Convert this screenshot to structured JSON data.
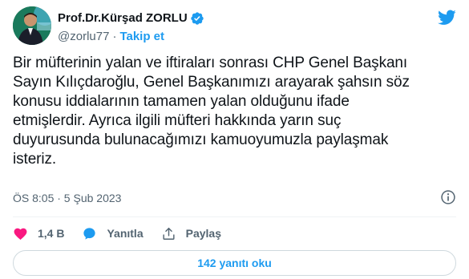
{
  "author": {
    "display_name": "Prof.Dr.Kürşad ZORLU",
    "handle": "@zorlu77",
    "separator": "·",
    "follow_label": "Takip et"
  },
  "tweet": {
    "text": "Bir müfterinin yalan ve iftiraları sonrası CHP Genel Başkanı\nSayın Kılıçdaroğlu, Genel Başkanımızı arayarak şahsın söz\nkonusu iddialarının tamamen yalan olduğunu ifade\netmişlerdir. Ayrıca ilgili müfteri hakkında yarın suç\nduyurusunda bulunacağımızı kamuoyumuzla paylaşmak\nisteriz.",
    "timestamp": "ÖS 8:05 · 5 Şub 2023"
  },
  "actions": {
    "like_count": "1,4 B",
    "reply_label": "Yanıtla",
    "share_label": "Paylaş"
  },
  "replies_button_label": "142 yanıtı oku",
  "colors": {
    "accent": "#1d9bf0",
    "like": "#f91880",
    "text": "#0f1419",
    "secondary": "#536471"
  },
  "icons": [
    "verified-badge-icon",
    "twitter-bird-icon",
    "info-icon",
    "heart-icon",
    "reply-bubble-icon",
    "share-icon"
  ]
}
